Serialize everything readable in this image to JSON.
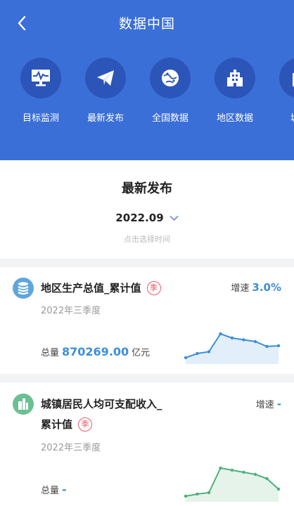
{
  "header": {
    "title": "数据中国"
  },
  "nav": [
    {
      "label": "目标监测",
      "icon": "monitor-icon"
    },
    {
      "label": "最新发布",
      "icon": "paper-plane-icon"
    },
    {
      "label": "全国数据",
      "icon": "globe-icon"
    },
    {
      "label": "地区数据",
      "icon": "building-icon"
    },
    {
      "label": "城市",
      "icon": "city-icon"
    }
  ],
  "section": {
    "title": "最新发布",
    "date": "2022.09",
    "date_hint": "点击选择时间"
  },
  "cards": [
    {
      "icon": "database-icon",
      "name": "地区生产总值_累计值",
      "badge": "季",
      "growth_label": "增速",
      "growth_value": "3.0%",
      "period": "2022年三季度",
      "total_label": "总量",
      "total_value": "870269.00",
      "total_unit": "亿元",
      "trend": [
        10,
        22,
        27,
        78,
        66,
        61,
        56,
        42,
        44
      ],
      "color": "#3b8fd8"
    },
    {
      "icon": "city-buildings-icon",
      "name_line1": "城镇居民人均可支配收入_",
      "name_line2": "累计值",
      "badge": "季",
      "growth_label": "增速",
      "growth_value": "-",
      "period": "2022年三季度",
      "total_label": "总量",
      "total_value": "-",
      "trend": [
        8,
        14,
        18,
        88,
        82,
        76,
        70,
        58,
        28
      ],
      "color": "#4fb07a"
    }
  ]
}
